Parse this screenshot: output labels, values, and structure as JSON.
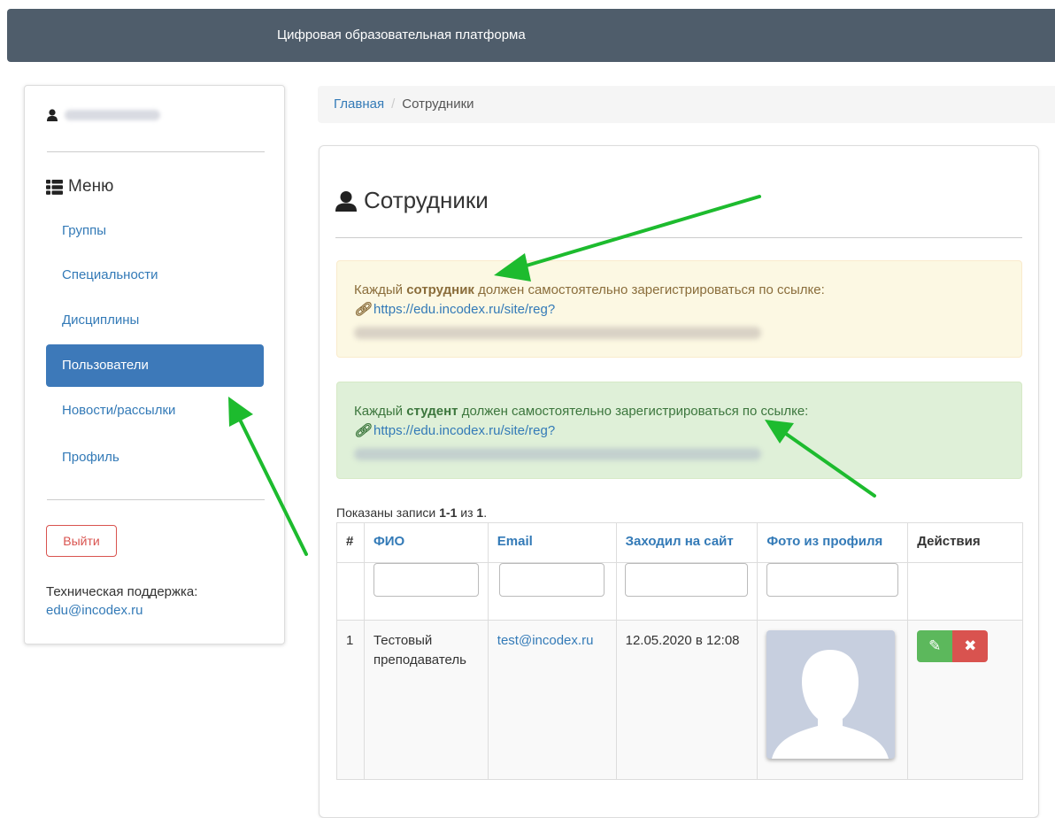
{
  "header": {
    "brand": "Цифровая образовательная платформа"
  },
  "sidebar": {
    "menu_title": "Меню",
    "items": [
      {
        "label": "Группы",
        "active": false
      },
      {
        "label": "Специальности",
        "active": false
      },
      {
        "label": "Дисциплины",
        "active": false
      },
      {
        "label": "Пользователи",
        "active": true
      },
      {
        "label": "Новости/рассылки",
        "active": false
      },
      {
        "label": "Профиль",
        "active": false
      }
    ],
    "logout_label": "Выйти",
    "support_label": "Техническая поддержка:",
    "support_email": "edu@incodex.ru"
  },
  "breadcrumb": {
    "home": "Главная",
    "current": "Сотрудники"
  },
  "page": {
    "title": "Сотрудники"
  },
  "alerts": {
    "staff": {
      "prefix": "Каждый",
      "bold": "сотрудник",
      "suffix": "должен самостоятельно зарегистрироваться по ссылке:",
      "link": "https://edu.incodex.ru/site/reg?"
    },
    "student": {
      "prefix": "Каждый",
      "bold": "студент",
      "suffix": "должен самостоятельно зарегистрироваться по ссылке:",
      "link": "https://edu.incodex.ru/site/reg?"
    }
  },
  "summary": {
    "prefix": "Показаны записи",
    "range": "1-1",
    "middle": "из",
    "total": "1",
    "end": "."
  },
  "table": {
    "headers": [
      "#",
      "ФИО",
      "Email",
      "Заходил на сайт",
      "Фото из профиля",
      "Действия"
    ],
    "rows": [
      {
        "index": "1",
        "name": "Тестовый преподаватель",
        "email": "test@incodex.ru",
        "last_visit": "12.05.2020 в 12:08"
      }
    ]
  },
  "icons": {
    "edit": "pencil-icon",
    "delete": "cross-icon",
    "link": "link-icon",
    "user": "user-icon",
    "menu": "list-icon"
  },
  "colors": {
    "navbar": "#4f5d6b",
    "active": "#3d79b9",
    "edit": "#5cb85c",
    "delete": "#d9534f",
    "arrow": "#1dbb2e"
  }
}
